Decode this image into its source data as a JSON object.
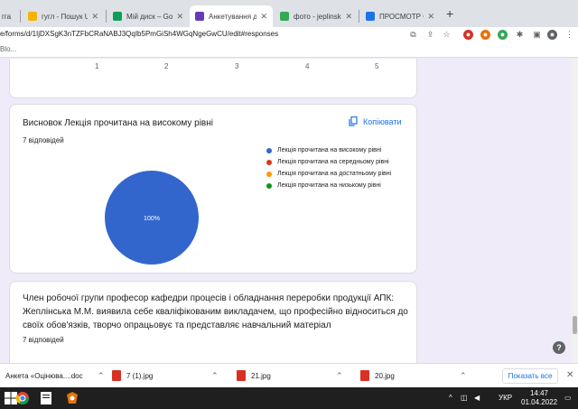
{
  "browser": {
    "tabs": [
      {
        "label": "гга",
        "favicon_color": "#f4b400"
      },
      {
        "label": "гугл - Пошук UK",
        "favicon_color": "#f4b400"
      },
      {
        "label": "Мій диск – Goog",
        "favicon_color": "#0f9d58"
      },
      {
        "label": "Анкетування да",
        "favicon_color": "#673ab7"
      },
      {
        "label": "фото - jeplinska@",
        "favicon_color": "#34a853"
      },
      {
        "label": "ПРОСМОТР ФАЙ",
        "favicon_color": "#1a73e8"
      }
    ],
    "new_tab": "+",
    "url": "e/forms/d/1IjDXSgK3nTZFbCRaNABJ3QqIb5PmGiSh4WGqNgeGwCU/edit#responses",
    "bookmarks_label": "Blo..."
  },
  "prev_chart": {
    "ticks": [
      "1",
      "2",
      "3",
      "4",
      "5"
    ]
  },
  "question1": {
    "title": "Висновок Лекція прочитана на високому рівні",
    "count": "7 відповідей",
    "copy_label": "Копіювати",
    "pie_label": "100%"
  },
  "chart_data": {
    "type": "pie",
    "categories": [
      "Лекція прочитана на високому рівні",
      "Лекція прочитана на середньому рівні",
      "Лекція прочитана на достатньому рівні",
      "Лекція прочитана на низькому рівні"
    ],
    "values": [
      100,
      0,
      0,
      0
    ],
    "colors": [
      "#3366cc",
      "#dc3912",
      "#ff9900",
      "#109618"
    ],
    "legend_position": "right"
  },
  "question2": {
    "title_line1": "Член робочої групи професор кафедри процесів і обладнання переробки продукції АПК:",
    "title_line2": "Жеплінська М.М. виявила себе кваліфікованим викладачем, що професійно відноситься до",
    "title_line3": "своїх обов'язків, творчо опрацьовує та представляє навчальний матеріал",
    "count": "7 відповідей"
  },
  "downloads": {
    "items": [
      "Анкета «Оцінюва....doc",
      "7 (1).jpg",
      "21.jpg",
      "20.jpg"
    ],
    "show_all": "Показать все"
  },
  "taskbar": {
    "lang": "УКР",
    "time": "14:47",
    "date": "01.04.2022"
  }
}
